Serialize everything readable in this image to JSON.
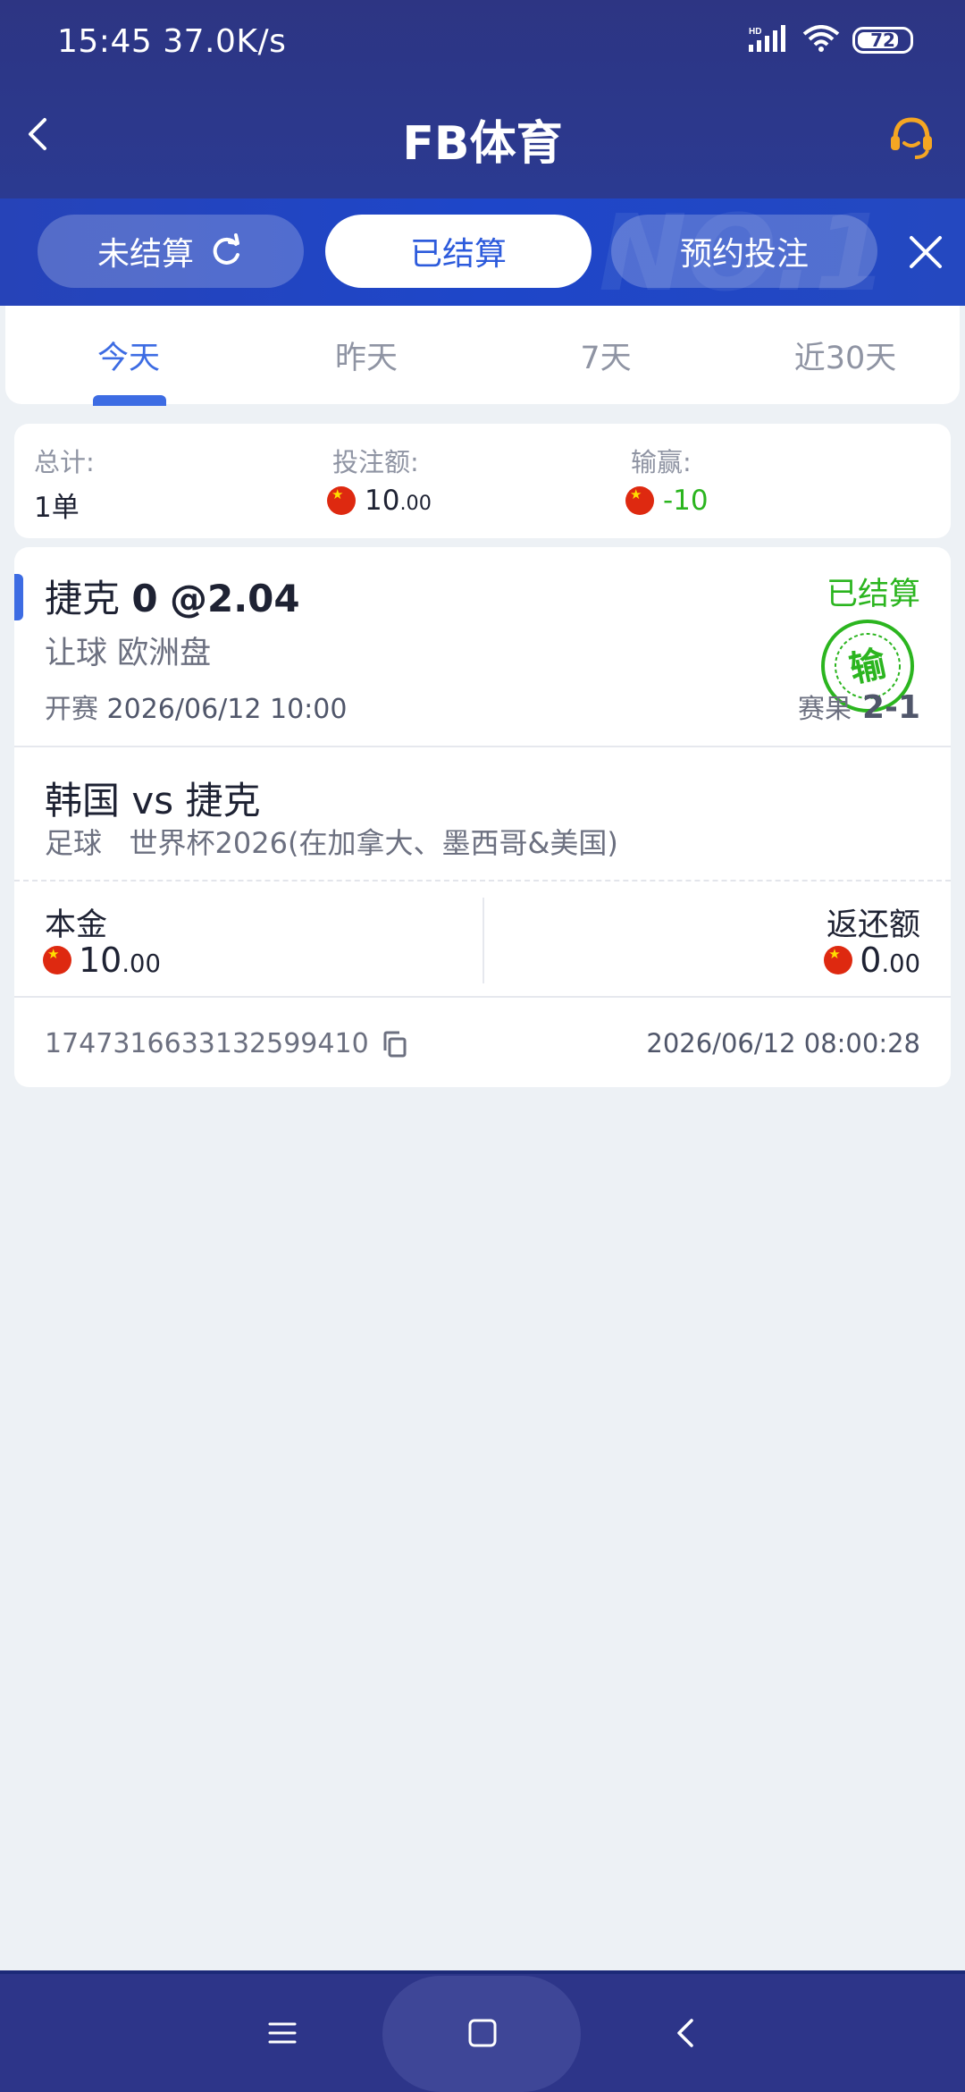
{
  "status_bar": {
    "time": "15:45",
    "speed": "37.0K/s",
    "network": "HD",
    "battery": "72"
  },
  "header": {
    "title": "FB体育"
  },
  "segments": [
    {
      "label": "未结算",
      "active": false
    },
    {
      "label": "已结算",
      "active": true
    },
    {
      "label": "预约投注",
      "active": false
    }
  ],
  "band_watermark": "NO.1",
  "period_tabs": [
    {
      "label": "今天",
      "active": true
    },
    {
      "label": "昨天",
      "active": false
    },
    {
      "label": "7天",
      "active": false
    },
    {
      "label": "近30天",
      "active": false
    }
  ],
  "summary": {
    "total_label": "总计:",
    "total_value": "1单",
    "stake_label": "投注额:",
    "stake_int": "10",
    "stake_dec": ".00",
    "pnl_label": "输赢:",
    "pnl_value": "-10"
  },
  "bet": {
    "team": "捷克",
    "handicap": "0",
    "odds": "@2.04",
    "market": "让球 欧洲盘",
    "start_label": "开赛",
    "start_time": "2026/06/12 10:00",
    "status": "已结算",
    "stamp_text": "输",
    "result_label": "赛果",
    "result_score": "2-1",
    "match": "韩国 vs 捷克",
    "sport": "足球",
    "league": "世界杯2026(在加拿大、墨西哥&美国)",
    "principal_label": "本金",
    "principal_int": "10",
    "principal_dec": ".00",
    "return_label": "返还额",
    "return_int": "0",
    "return_dec": ".00",
    "order_id": "1747316633132599410",
    "order_time": "2026/06/12 08:00:28"
  },
  "colors": {
    "header_bg": "#2d3583",
    "band_bg": "#1e46c9",
    "accent_blue": "#3d6ce3",
    "win_lose_green": "#2bb51f",
    "support_icon": "#f5a623"
  }
}
